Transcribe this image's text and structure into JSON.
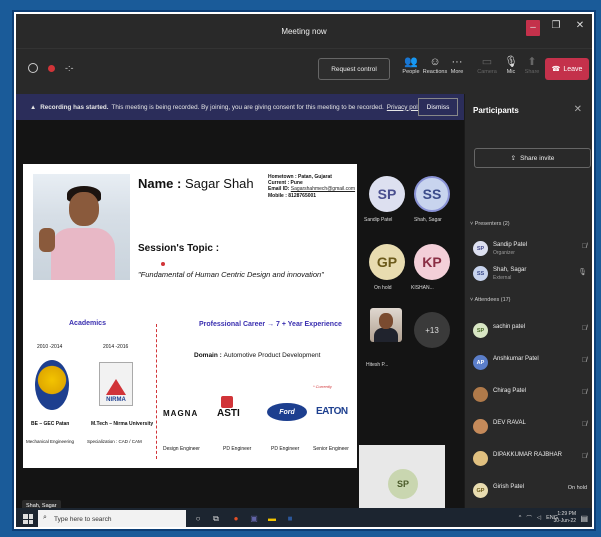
{
  "window": {
    "title": "Meeting now"
  },
  "toolbar": {
    "timer": "-:-",
    "request_control": "Request control",
    "people": "People",
    "reactions": "Reactions",
    "more": "More",
    "camera": "Camera",
    "mic": "Mic",
    "share": "Share",
    "leave": "Leave"
  },
  "banner": {
    "bold": "Recording has started.",
    "text": "This meeting is being recorded. By joining, you are giving consent for this meeting to be recorded.",
    "link": "Privacy policy",
    "dismiss": "Dismiss"
  },
  "slide": {
    "name_label": "Name :",
    "name_value": "Sagar Shah",
    "hometown": "Hometown : Patan, Gujarat",
    "current": "Current : Pune",
    "email_label": "Email ID:",
    "email_value": "Sagarshahmech@gmail.com",
    "mobile": "Mobile : 8128765001",
    "topic_label": "Session's Topic :",
    "topic_value": "\"Fundamental of Human Centric Design and innovation\"",
    "academics": "Academics",
    "professional": "Professional Career → 7 + Year Experience",
    "year1": "2010 -2014",
    "year2": "2014 -2016",
    "nirma": "NIRMA",
    "deg1": "BE – GEC Patan",
    "deg2": "M.Tech – Nirma University",
    "spec1": "Mechanical Engineering",
    "spec2": "Specialization : CAD / CAM",
    "domain_label": "Domain :",
    "domain_value": "Automotive Product Development",
    "currently": "* Currently",
    "logo_magna": "MAGNA",
    "logo_asti": "ASTI",
    "logo_ford": "Ford",
    "logo_eaton": "EATON",
    "role1": "Design Engineer",
    "role2": "PD Engineer",
    "role3": "PD Engineer",
    "role4": "Senior Engineer"
  },
  "presenter_label": "Shah, Sagar",
  "tiles": [
    {
      "initials": "SP",
      "name": "Sandip Patel",
      "bg": "#dde0f0",
      "fg": "#4a4f8f"
    },
    {
      "initials": "SS",
      "name": "Shah, Sagar",
      "bg": "#c8d4ee",
      "fg": "#3b4b8a"
    },
    {
      "initials": "GP",
      "name": "On hold",
      "bg": "#e8dcb0",
      "fg": "#6b5a1a"
    },
    {
      "initials": "KP",
      "name": "KISHAN...",
      "bg": "#f3cfd8",
      "fg": "#8a2e44"
    },
    {
      "initials": "",
      "name": "Hitesh P..."
    },
    {
      "initials": "+13",
      "name": ""
    }
  ],
  "self_view": {
    "initials": "SP"
  },
  "panel": {
    "title": "Participants",
    "share_invite": "Share invite",
    "presenters_header": "Presenters (2)",
    "attendees_header": "Attendees (17)",
    "presenters": [
      {
        "initials": "SP",
        "name": "Sandip Patel",
        "role": "Organizer",
        "bg": "#dde0f0",
        "fg": "#4a4f8f"
      },
      {
        "initials": "SS",
        "name": "Shah, Sagar",
        "role": "External",
        "bg": "#c8d4ee",
        "fg": "#3b4b8a"
      }
    ],
    "attendees": [
      {
        "initials": "SP",
        "name": "sachin patel",
        "bg": "#d8e6c4",
        "fg": "#4b6b2a"
      },
      {
        "initials": "AP",
        "name": "Anshkumar Patel",
        "bg": "#5b7ec9",
        "fg": "#ffffff"
      },
      {
        "initials": "",
        "name": "Chirag Patel",
        "bg": "#b07a4a",
        "fg": "#ffffff"
      },
      {
        "initials": "",
        "name": "DEV RAVAL",
        "bg": "#c58a5a",
        "fg": "#ffffff"
      },
      {
        "initials": "",
        "name": "DIPAKKUMAR RAJBHAR",
        "bg": "#e0c080",
        "fg": "#ffffff"
      },
      {
        "initials": "GP",
        "name": "Girish Patel",
        "bg": "#e8dcb0",
        "fg": "#6b5a1a",
        "status": "On hold"
      }
    ]
  },
  "taskbar": {
    "search_placeholder": "Type here to search",
    "lang": "ENG",
    "time": "1:29 PM",
    "date": "30-Jun-22"
  }
}
